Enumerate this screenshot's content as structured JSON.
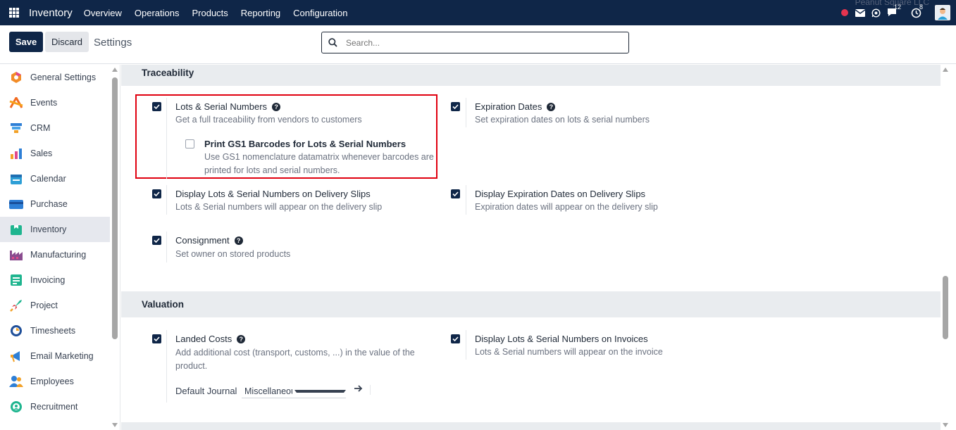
{
  "navbar": {
    "brand": "Inventory",
    "menu": [
      "Overview",
      "Operations",
      "Products",
      "Reporting",
      "Configuration"
    ],
    "company": "Peanut Square LLC",
    "chat_count": "12",
    "activity_count": "8"
  },
  "control": {
    "save_label": "Save",
    "discard_label": "Discard",
    "title": "Settings",
    "search_placeholder": "Search..."
  },
  "sidebar": {
    "items": [
      {
        "label": "General Settings",
        "icon": "general-settings-icon"
      },
      {
        "label": "Events",
        "icon": "events-icon"
      },
      {
        "label": "CRM",
        "icon": "crm-icon"
      },
      {
        "label": "Sales",
        "icon": "sales-icon"
      },
      {
        "label": "Calendar",
        "icon": "calendar-icon"
      },
      {
        "label": "Purchase",
        "icon": "purchase-icon"
      },
      {
        "label": "Inventory",
        "icon": "inventory-icon",
        "active": true
      },
      {
        "label": "Manufacturing",
        "icon": "manufacturing-icon"
      },
      {
        "label": "Invoicing",
        "icon": "invoicing-icon"
      },
      {
        "label": "Project",
        "icon": "project-icon"
      },
      {
        "label": "Timesheets",
        "icon": "timesheets-icon"
      },
      {
        "label": "Email Marketing",
        "icon": "email-marketing-icon"
      },
      {
        "label": "Employees",
        "icon": "employees-icon"
      },
      {
        "label": "Recruitment",
        "icon": "recruitment-icon"
      }
    ]
  },
  "traceability": {
    "heading": "Traceability",
    "lots": {
      "title": "Lots & Serial Numbers",
      "desc": "Get a full traceability from vendors to customers",
      "checked": true
    },
    "gs1": {
      "title": "Print GS1 Barcodes for Lots & Serial Numbers",
      "desc": "Use GS1 nomenclature datamatrix whenever barcodes are printed for lots and serial numbers.",
      "checked": false
    },
    "expiration": {
      "title": "Expiration Dates",
      "desc": "Set expiration dates on lots & serial numbers",
      "checked": true
    },
    "lots_delivery": {
      "title": "Display Lots & Serial Numbers on Delivery Slips",
      "desc": "Lots & Serial numbers will appear on the delivery slip",
      "checked": true
    },
    "exp_delivery": {
      "title": "Display Expiration Dates on Delivery Slips",
      "desc": "Expiration dates will appear on the delivery slip",
      "checked": true
    },
    "consignment": {
      "title": "Consignment",
      "desc": "Set owner on stored products",
      "checked": true
    }
  },
  "valuation": {
    "heading": "Valuation",
    "landed": {
      "title": "Landed Costs",
      "desc": "Add additional cost (transport, customs, ...) in the value of the product.",
      "checked": true
    },
    "journal_label": "Default Journal",
    "journal_value": "Miscellaneous Operations",
    "lots_invoices": {
      "title": "Display Lots & Serial Numbers on Invoices",
      "desc": "Lots & Serial numbers will appear on the invoice",
      "checked": true
    }
  },
  "colors": {
    "navbar": "#0f2648",
    "highlight": "#e0000f",
    "section_bg": "#e9ecef"
  }
}
